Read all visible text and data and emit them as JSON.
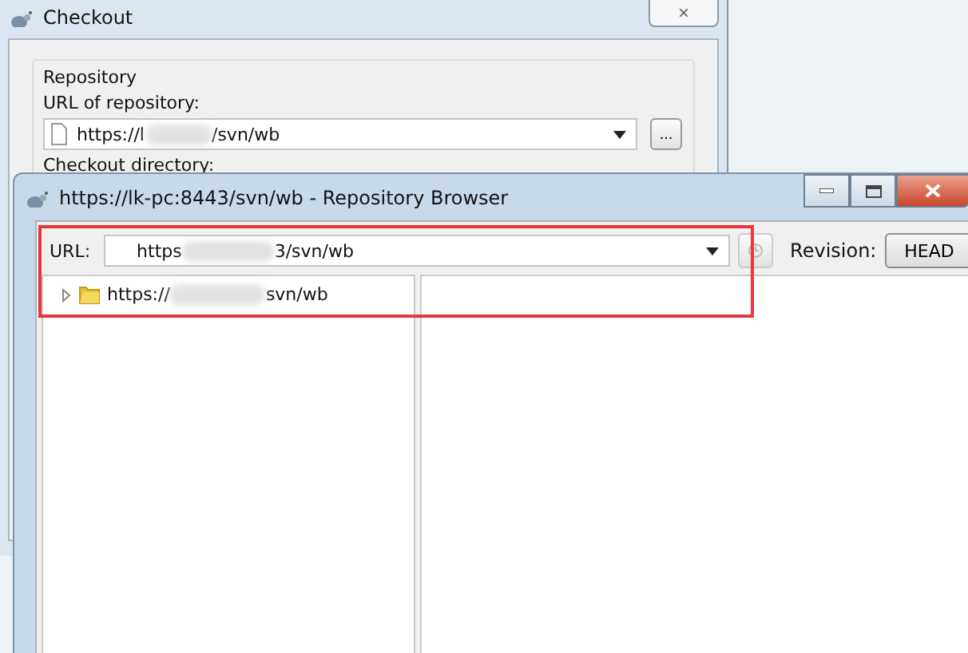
{
  "checkout_window": {
    "title": "Checkout",
    "close_button": "×",
    "group_label": "Repository",
    "url_label": "URL of repository:",
    "url_value_start": "https://l",
    "url_value_end": "/svn/wb",
    "browse_button": "...",
    "directory_label": "Checkout directory:"
  },
  "repo_browser": {
    "title": "https://lk-pc:8443/svn/wb - Repository Browser",
    "url_label": "URL:",
    "url_value_start": "https",
    "url_value_end": "3/svn/wb",
    "revision_label": "Revision:",
    "revision_button": "HEAD",
    "tree": [
      {
        "label_start": "https://",
        "label_end": "svn/wb",
        "expanded": false
      }
    ]
  }
}
